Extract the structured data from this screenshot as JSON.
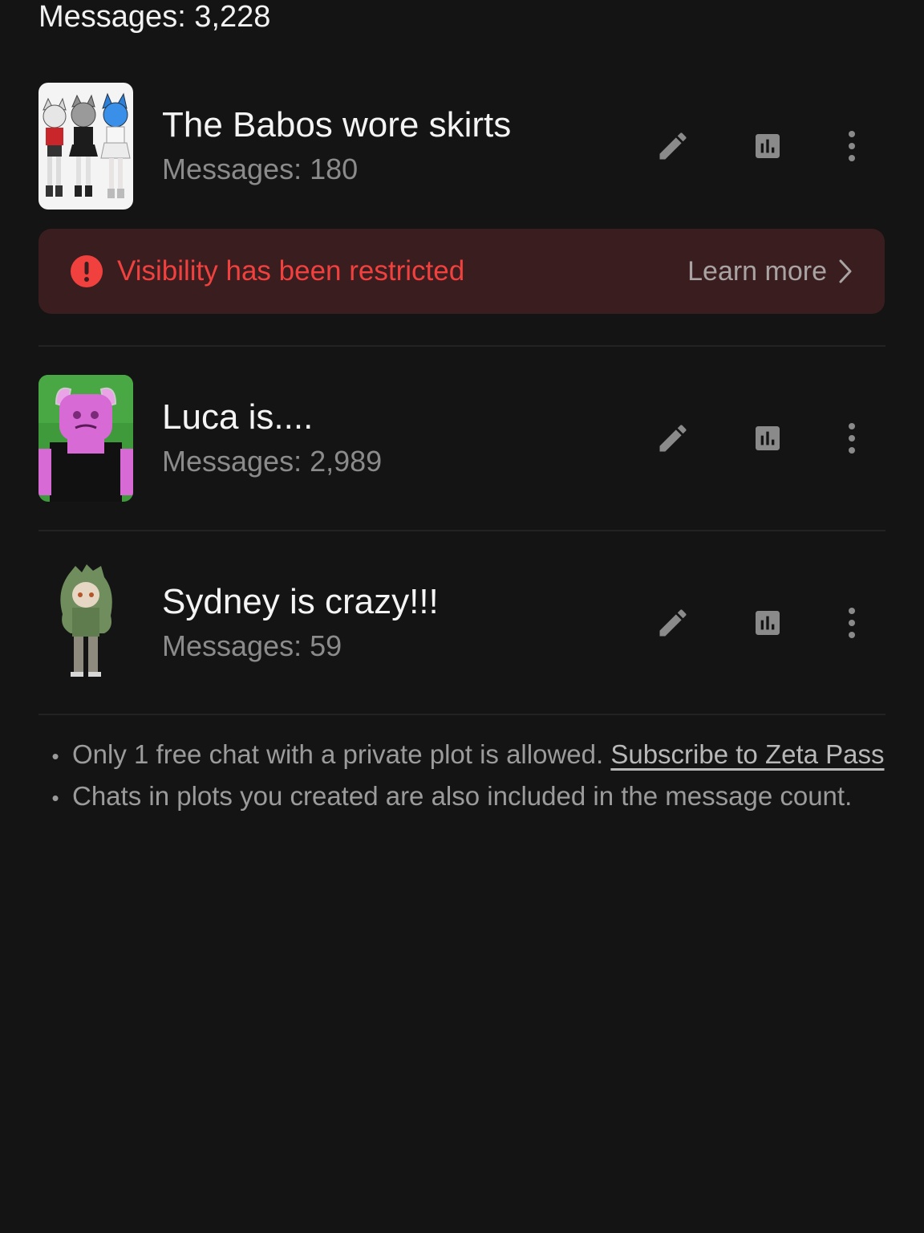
{
  "total_messages": "Messages: 3,228",
  "chats": [
    {
      "title": "The Babos wore skirts",
      "messages": "Messages: 180",
      "thumbnail": "three-cat-characters-image"
    },
    {
      "title": "Luca is....",
      "messages": "Messages: 2,989",
      "thumbnail": "pink-cat-avatar-image"
    },
    {
      "title": "Sydney is crazy!!!",
      "messages": "Messages: 59",
      "thumbnail": "green-haired-character-image"
    }
  ],
  "banner": {
    "message": "Visibility has been restricted",
    "learn_more": "Learn more",
    "icon": "alert-circle-icon",
    "text_color": "#f0413f",
    "background": "#3a1d1f"
  },
  "notes": {
    "note1_text": "Only 1 free chat with a private plot is allowed.",
    "note1_link": "Subscribe to Zeta Pass",
    "note2_text": "Chats in plots you created are also included in the message count."
  },
  "icons": {
    "edit": "pencil-icon",
    "stats": "bar-chart-icon",
    "more": "vertical-dots-icon"
  },
  "colors": {
    "background": "#141414",
    "icon": "#8a8a8a"
  }
}
